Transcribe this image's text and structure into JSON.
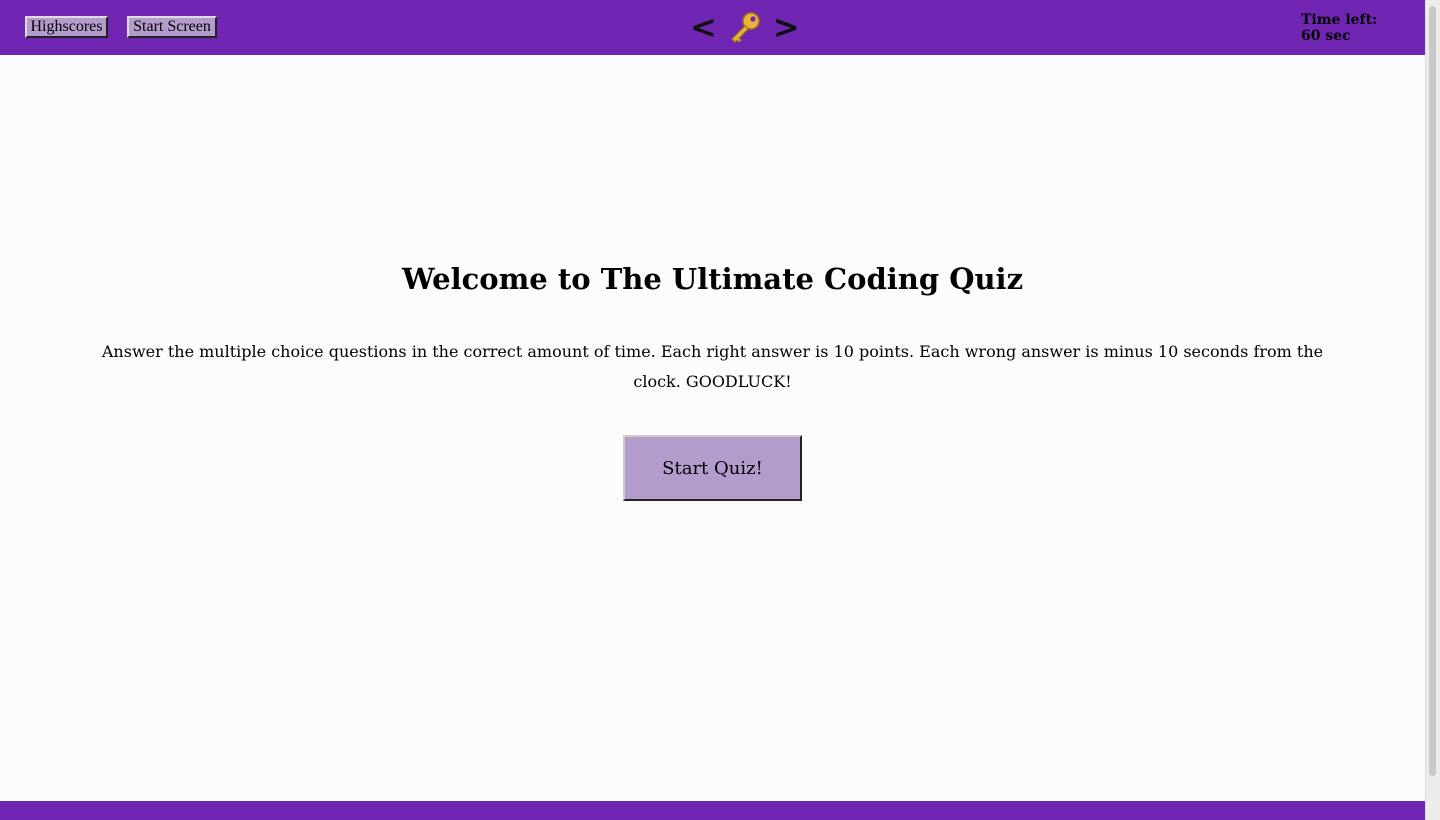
{
  "header": {
    "highscores_label": "Highscores",
    "start_screen_label": "Start Screen",
    "logo_left": "<",
    "logo_icon": "key-icon",
    "logo_right": ">",
    "timer_label": "Time left:",
    "timer_value": "60 sec"
  },
  "main": {
    "title": "Welcome to The Ultimate Coding Quiz",
    "description": "Answer the multiple choice questions in the correct amount of time. Each right answer is 10 points. Each wrong answer is minus 10 seconds from the clock. GOODLUCK!",
    "start_button_label": "Start Quiz!"
  },
  "colors": {
    "header_bg": "#7126b3",
    "button_bg": "#b39bcc",
    "page_bg": "#fcfcfd"
  }
}
